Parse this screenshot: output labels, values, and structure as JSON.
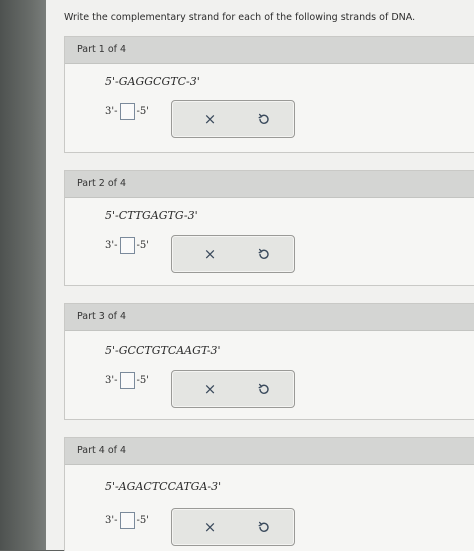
{
  "instruction": "Write the complementary strand for each of the following strands of DNA.",
  "parts": [
    {
      "header": "Part 1 of 4",
      "strand": "5'-GAGGCGTC-3'",
      "answer_prefix": "3'-",
      "answer_suffix": "-5'",
      "answer_value": ""
    },
    {
      "header": "Part 2 of 4",
      "strand": "5'-CTTGAGTG-3'",
      "answer_prefix": "3'-",
      "answer_suffix": "-5'",
      "answer_value": ""
    },
    {
      "header": "Part 3 of 4",
      "strand": "5'-GCCTGTCAAGT-3'",
      "answer_prefix": "3'-",
      "answer_suffix": "-5'",
      "answer_value": ""
    },
    {
      "header": "Part 4 of 4",
      "strand": "5'-AGACTCCATGA-3'",
      "answer_prefix": "3'-",
      "answer_suffix": "-5'",
      "answer_value": ""
    }
  ],
  "controls": {
    "clear_symbol": "×",
    "undo_icon": "undo-icon"
  },
  "colors": {
    "page_background": "#f1f1ef",
    "part_header": "#d4d5d3",
    "control_icon": "#3a4a5c",
    "answer_border": "#7b8a9b"
  }
}
